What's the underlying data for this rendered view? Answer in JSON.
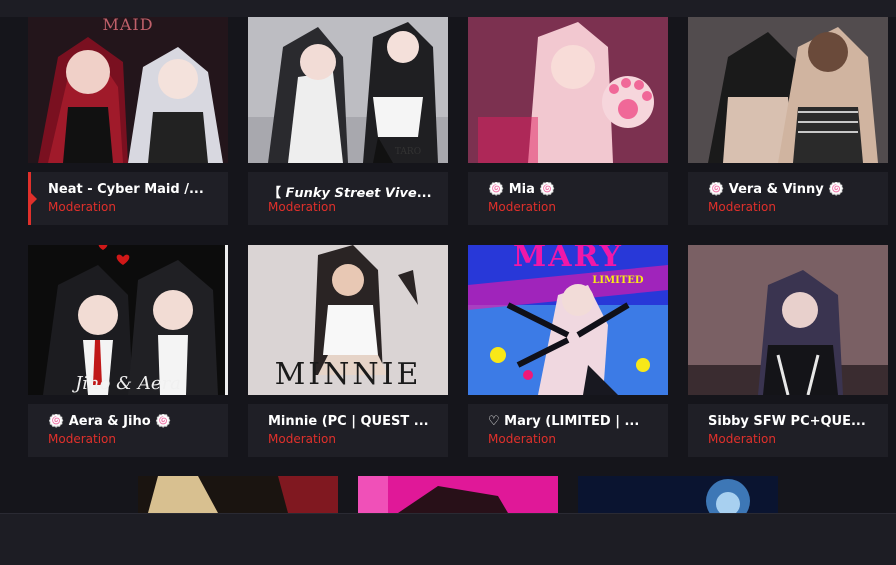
{
  "cards": [
    {
      "title": "Neat - Cyber Maid /...",
      "subtitle": "Moderation",
      "image_text": "MAID"
    },
    {
      "title": "【 𝙁𝙪𝙣𝙠𝙮 𝙎𝙩𝙧𝙚𝙚𝙩 𝙑𝙞𝙫𝙚...",
      "subtitle": "Moderation",
      "image_text": "TARO"
    },
    {
      "title": "🍥 Mia 🍥",
      "subtitle": "Moderation"
    },
    {
      "title": "🍥 Vera & Vinny 🍥",
      "subtitle": "Moderation"
    },
    {
      "title": "🍥 Aera & Jiho 🍥",
      "subtitle": "Moderation",
      "image_text": "Jiho & Aera"
    },
    {
      "title": "Minnie (PC | QUEST ...",
      "subtitle": "Moderation",
      "image_text": "MINNIE"
    },
    {
      "title": "♡ Mary (LIMITED | ...",
      "subtitle": "Moderation",
      "image_text": "MARY",
      "image_subtext": "LIMITED"
    },
    {
      "title": "Sibby SFW PC+QUE...",
      "subtitle": "Moderation"
    }
  ],
  "colors": {
    "accent": "#e0302b",
    "card_bg": "#1f1f26",
    "page_bg": "#15151b"
  }
}
